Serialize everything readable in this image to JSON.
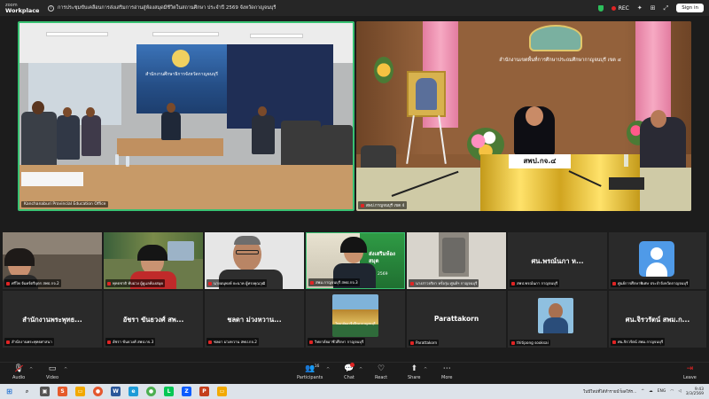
{
  "app": {
    "brand_top": "zoom",
    "brand_bottom": "Workplace"
  },
  "meeting": {
    "title": "การประชุมขับเคลื่อนการส่งเสริมการอ่านสู่ห้องสมุดมีชีวิตในสถานศึกษา ประจำปี 2569 จังหวัดกาญจนบุรี",
    "rec_label": "REC",
    "sign_in_label": "Sign in"
  },
  "main_tiles": {
    "left": {
      "name": "Kanchanaburi Provincial Education Office",
      "banner_text": "สำนักงานศึกษาธิการจังหวัดกาญจนบุรี"
    },
    "right": {
      "name": "สพป.กาญจนบุรี เขต 4",
      "office_title": "สำนักงานเขตพื้นที่การศึกษาประถมศึกษากาญจนบุรี เขต ๔",
      "sign_text": "สพป.กจ.๔"
    }
  },
  "gallery_row1": [
    {
      "label": "ศรีไพ จันทร์ตรีบุตร สพป.กจ.2"
    },
    {
      "label": "พุทธชาติ ทับม่วง ผู้ดูแลห้องสมุด"
    },
    {
      "label": "นายอนุพงษ์ ยะนาค ผู้ทรงคุณวุฒิ"
    },
    {
      "label": "สพม.กาญจนบุรี สพป.กจ.3",
      "poster_text": "ส่งเสริมห้องสมุด",
      "poster_year": "2569"
    },
    {
      "label": "นางสาวจริยา หรั่งกุ่ม ศูนย์ฯ กาญจนบุรี"
    },
    {
      "label": "สพป.พรณ์นภา กาญจนบุรี",
      "display_name": "ศน.พรณ์นภา  ห..."
    },
    {
      "label": "ศูนย์การศึกษาพิเศษ ประจำจังหวัดกาญจนบุรี"
    }
  ],
  "gallery_row2": [
    {
      "label": "สำนักงานพระพุทธศาสนา",
      "display_name": "สำนักงานพระพุทธ..."
    },
    {
      "label": "อัชรา ขันธวงศ์ สพป.กจ.3",
      "display_name": "อัชรา ขันธวงศ์ สพ..."
    },
    {
      "label": "ชลดา ม่วงหวาน สพป.กจ.2",
      "display_name": "ชลดา ม่วงหวาน..."
    },
    {
      "label": "วิทยาลัยอาชีวศึกษา กาญจนบุรี",
      "poster_text": "วิทยาลัยอาชีวศึกษากาญจนบุรี"
    },
    {
      "label": "Parattakorn",
      "display_name": "Parattakorn"
    },
    {
      "label": "thitipong sooksai"
    },
    {
      "label": "ศน.จิรวรัตน์ สพม.กาญจนบุรี",
      "display_name": "ศน.จิรวรัตน์ สพม.ก..."
    }
  ],
  "toolbar": {
    "audio": "Audio",
    "video": "Video",
    "participants": "Participants",
    "participants_count": "16",
    "chat": "Chat",
    "react": "React",
    "share": "Share",
    "more": "More",
    "leave": "Leave"
  },
  "taskbar": {
    "notification": "ในปีใหม่ที่ได้ทำรายนำ้ผลให้ร...",
    "lang": "ENG",
    "time": "9:43",
    "date": "3/3/2569"
  },
  "colors": {
    "active_speaker_border": "#38c172",
    "rec": "#e02424",
    "avatar": "#4f9ae8"
  }
}
